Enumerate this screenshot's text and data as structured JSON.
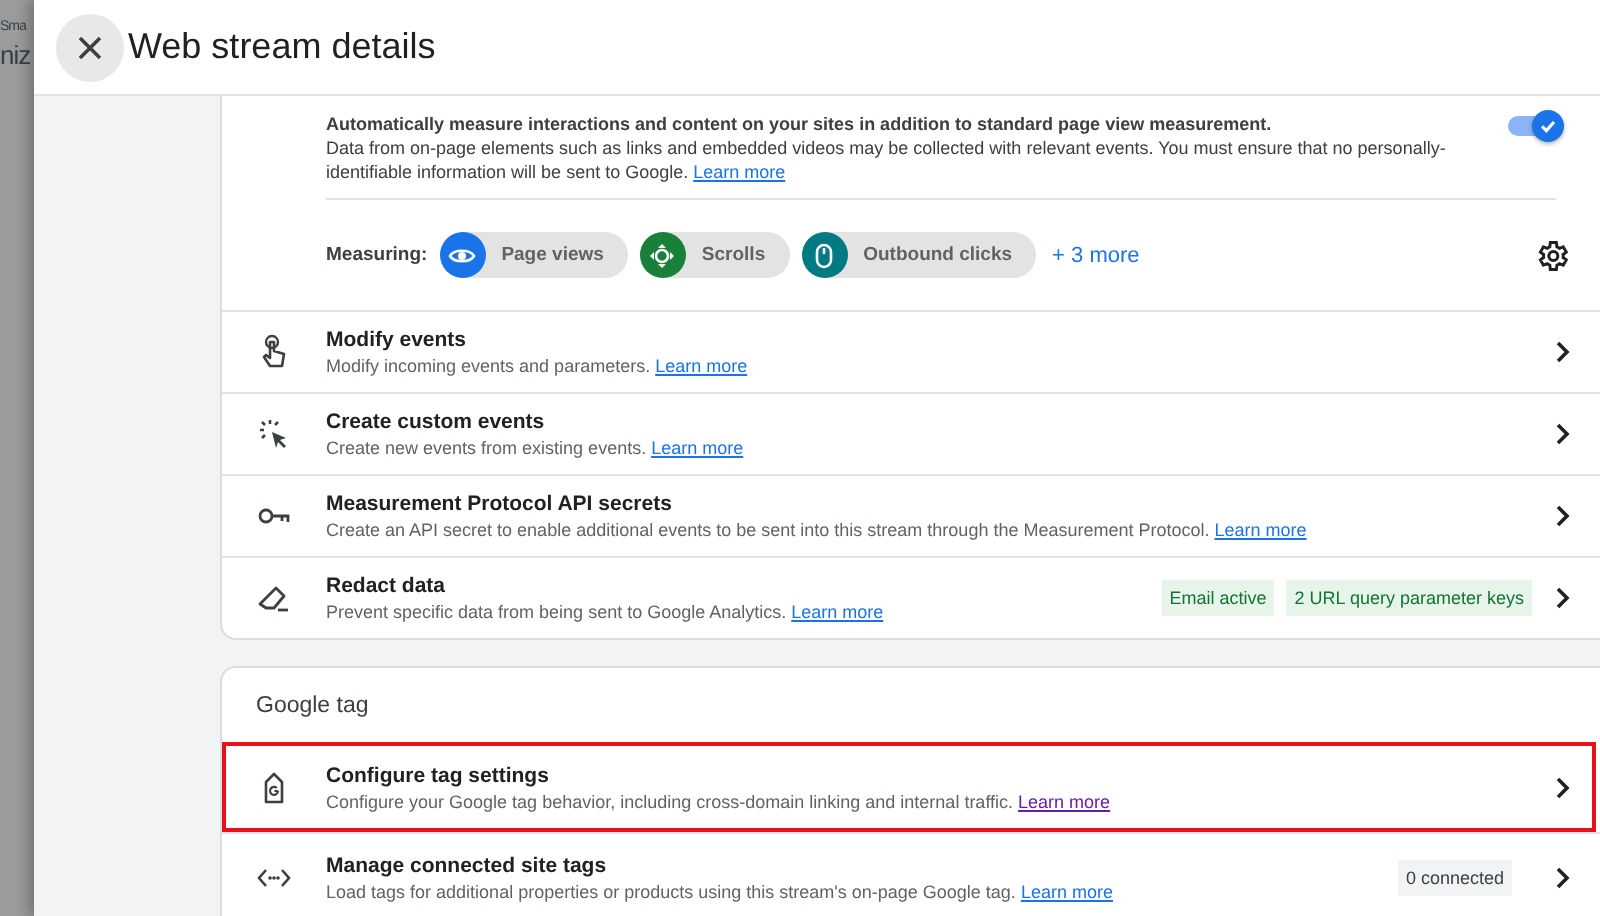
{
  "backdrop": {
    "texts": [
      "Sma",
      "niz"
    ]
  },
  "window": {
    "title": "Web stream details"
  },
  "enhanced_measurement": {
    "heading": "Automatically measure interactions and content on your sites in addition to standard page view measurement.",
    "description": "Data from on-page elements such as links and embedded videos may be collected with relevant events. You must ensure that no personally-identifiable information will be sent to Google.",
    "link": "Learn more",
    "on": true,
    "measuring_label": "Measuring:",
    "chips": [
      {
        "kind": "eye",
        "label": "Page views",
        "color": "#1a73e8"
      },
      {
        "kind": "target",
        "label": "Scrolls",
        "color": "#188038"
      },
      {
        "kind": "mouse",
        "label": "Outbound clicks",
        "color": "#007b83"
      }
    ],
    "more": "+ 3 more"
  },
  "event_rows": [
    {
      "kind": "touch",
      "title": "Modify events",
      "description": "Modify incoming events and parameters.",
      "link": "Learn more",
      "badges": []
    },
    {
      "kind": "sparkle",
      "title": "Create custom events",
      "description": "Create new events from existing events.",
      "link": "Learn more",
      "badges": []
    },
    {
      "kind": "key",
      "title": "Measurement Protocol API secrets",
      "description": "Create an API secret to enable additional events to be sent into this stream through the Measurement Protocol.",
      "link": "Learn more",
      "badges": []
    },
    {
      "kind": "eraser",
      "title": "Redact data",
      "description": "Prevent specific data from being sent to Google Analytics.",
      "link": "Learn more",
      "badges": [
        "Email active",
        "2 URL query parameter keys"
      ]
    }
  ],
  "google_tag": {
    "heading": "Google tag",
    "rows": [
      {
        "kind": "tag",
        "title": "Configure tag settings",
        "description": "Configure your Google tag behavior, including cross-domain linking and internal traffic.",
        "link": "Learn more",
        "link_visited": true,
        "highlighted": true,
        "count": ""
      },
      {
        "kind": "code",
        "title": "Manage connected site tags",
        "description": "Load tags for additional properties or products using this stream's on-page Google tag.",
        "link": "Learn more",
        "link_visited": false,
        "highlighted": false,
        "count": "0 connected"
      }
    ]
  }
}
